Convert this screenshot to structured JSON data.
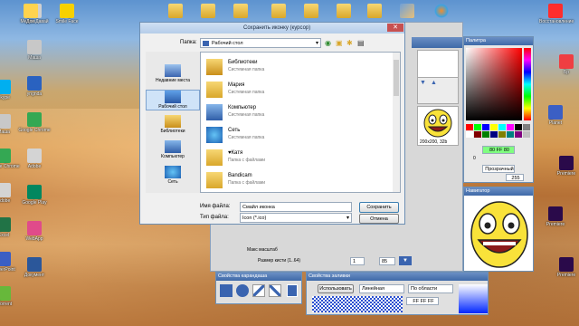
{
  "desktop": {
    "icons_left": [
      {
        "label": "Skype",
        "color": "#00aff0"
      },
      {
        "label": "Маша",
        "color": "#c8c8c8"
      },
      {
        "label": "Google Chrome",
        "color": "#34a853"
      },
      {
        "label": "Adobe",
        "color": "#d4d4d4"
      },
      {
        "label": "Excel",
        "color": "#217346"
      },
      {
        "label": "PowerPoint",
        "color": "#3b5fc4"
      },
      {
        "label": "uTorrent",
        "color": "#67b83b"
      }
    ],
    "icons_second_col": [
      {
        "label": "Медиа Давай",
        "color": "#d0d0d0"
      },
      {
        "label": "Маша",
        "color": "#c8c8c8"
      },
      {
        "label": "yngnda",
        "color": "#2a62c0"
      },
      {
        "label": "Google Chrome",
        "color": "#34a853"
      },
      {
        "label": "Adobe",
        "color": "#d4d4d4"
      },
      {
        "label": "Google Play",
        "color": "#01875f"
      },
      {
        "label": "WebApp",
        "color": "#e04b8a"
      },
      {
        "label": "Документ",
        "color": "#2b579a"
      }
    ],
    "icons_top": [
      {
        "label": "Дом",
        "color": "#ffd34e"
      },
      {
        "label": "Smile Face",
        "color": "#f7d100"
      }
    ],
    "icons_right": [
      {
        "label": "Восстановление",
        "color": "#ff2d2d"
      },
      {
        "label": "Бр",
        "color": "#ef3e42"
      },
      {
        "label": "Planet",
        "color": "#3b5fc4"
      },
      {
        "label": "Premiere",
        "color": "#2a0a4a"
      },
      {
        "label": "Premiere",
        "color": "#2a0a4a"
      },
      {
        "label": "Premiere",
        "color": "#2a0a4a"
      }
    ]
  },
  "dialog": {
    "title": "Сохранить иконку (курсор)",
    "folder_label": "Папка:",
    "folder_value": "Рабочий стол",
    "places": [
      {
        "label": "Недавние места",
        "icon": "recent-places-icon"
      },
      {
        "label": "Рабочий стол",
        "icon": "desktop-icon"
      },
      {
        "label": "Библиотеки",
        "icon": "libraries-icon"
      },
      {
        "label": "Компьютер",
        "icon": "computer-icon"
      },
      {
        "label": "Сеть",
        "icon": "network-icon"
      }
    ],
    "files": [
      {
        "name": "Библиотеки",
        "type": "Системная папка",
        "icon": "libraries-icon"
      },
      {
        "name": "Мария",
        "type": "Системная папка",
        "icon": "user-folder-icon"
      },
      {
        "name": "Компьютер",
        "type": "Системная папка",
        "icon": "computer-icon"
      },
      {
        "name": "Сеть",
        "type": "Системная папка",
        "icon": "network-icon"
      },
      {
        "name": "♥Катя",
        "type": "Папка с файлами",
        "icon": "folder-icon"
      },
      {
        "name": "Bandicam",
        "type": "Папка с файлами",
        "icon": "folder-icon"
      }
    ],
    "filename_label": "Имя файла:",
    "filename_value": "Смайл иконка",
    "filetype_label": "Тип файла:",
    "filetype_value": "Icon (*.ico)",
    "save_button": "Сохранить",
    "cancel_button": "Отмена"
  },
  "editor": {
    "preview_size": "200x200, 32b",
    "palette_title": "Палитра",
    "color_hex": "80 FF 80",
    "transparent_label": "Прозрачный",
    "alpha_value": "255",
    "alpha_min": "0",
    "navigator_title": "Навигатор",
    "zoom_label": "Макс масштаб",
    "brush_label": "Размер кисти (1..64)",
    "brush_value": "1",
    "zoom_value": "85",
    "brush_props_title": "Свойства карандаша",
    "fill_props_title": "Свойства заливки",
    "fill_use_label": "Использовать",
    "fill_type": "Линейная",
    "fill_area": "По области",
    "fill_color": "FF FF FF"
  }
}
